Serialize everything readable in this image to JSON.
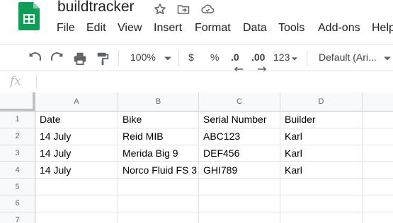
{
  "document": {
    "title": "buildtracker"
  },
  "header_icons": [
    "star-icon",
    "move-to-folder-icon",
    "cloud-status-icon"
  ],
  "menu": [
    "File",
    "Edit",
    "View",
    "Insert",
    "Format",
    "Data",
    "Tools",
    "Add-ons",
    "Help"
  ],
  "toolbar": {
    "zoom": "100%",
    "currency": "$",
    "percent": "%",
    "decrease_decimal": ".0",
    "increase_decimal": ".00",
    "more_formats": "123",
    "font": "Default (Ari..."
  },
  "formula_bar": {
    "fx_label": "fx",
    "value": ""
  },
  "sheet": {
    "columns": [
      "A",
      "B",
      "C",
      "D"
    ],
    "row_numbers": [
      "1",
      "2",
      "3",
      "4",
      "5",
      "6",
      "7"
    ],
    "rows": [
      [
        "Date",
        "Bike",
        "Serial Number",
        "Builder"
      ],
      [
        "14 July",
        "Reid MIB",
        "ABC123",
        "Karl"
      ],
      [
        "14 July",
        "Merida Big 9",
        "DEF456",
        "Karl"
      ],
      [
        "14 July",
        "Norco Fluid FS 3",
        "GHI789",
        "Karl"
      ],
      [
        "",
        "",
        "",
        ""
      ],
      [
        "",
        "",
        "",
        ""
      ],
      [
        "",
        "",
        "",
        ""
      ]
    ]
  },
  "colors": {
    "sheets_green": "#0F9D58",
    "header_bg": "#f8f9fa",
    "grid_line": "#e2e2e2"
  }
}
